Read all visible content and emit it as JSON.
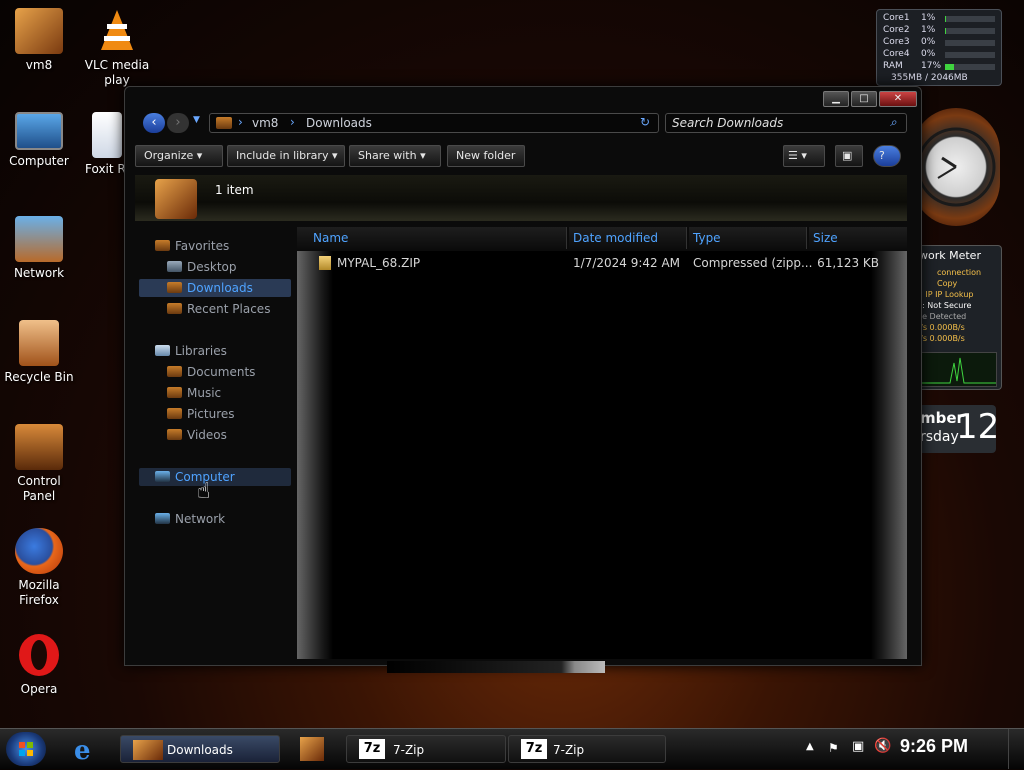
{
  "desktop": {
    "icons": [
      {
        "label": "vm8"
      },
      {
        "label": "VLC media play"
      },
      {
        "label": "Computer"
      },
      {
        "label": "Foxit R"
      },
      {
        "label": "Network"
      },
      {
        "label": "Recycle Bin"
      },
      {
        "label": "Control Panel"
      },
      {
        "label": "Mozilla Firefox"
      },
      {
        "label": "Opera"
      }
    ]
  },
  "gadgets": {
    "cpu_meter": {
      "rows": [
        {
          "name": "Core1",
          "value": "1%",
          "level": 0.01
        },
        {
          "name": "Core2",
          "value": "1%",
          "level": 0.01
        },
        {
          "name": "Core3",
          "value": "0%",
          "level": 0
        },
        {
          "name": "Core4",
          "value": "0%",
          "level": 0
        },
        {
          "name": "RAM",
          "value": "17%",
          "level": 0.17
        }
      ],
      "memory": "355MB / 2046MB"
    },
    "network_meter": {
      "title": "work Meter",
      "lines": [
        "connection Copy",
        "t: IP   IP Lookup",
        "n: Not Secure",
        "ne Detected",
        "t/s   0.000B/s",
        "t/s   0.000B/s"
      ]
    },
    "calendar": {
      "month_partial": "mber",
      "weekday_partial": "rsday",
      "day": "12"
    }
  },
  "explorer": {
    "title_buttons": {
      "minimize": "▁",
      "maximize": "□",
      "close": "✕"
    },
    "breadcrumb": [
      "vm8",
      "Downloads"
    ],
    "search_placeholder": "Search Downloads",
    "toolbar": {
      "organize": "Organize",
      "include_in_library": "Include in library",
      "share_with": "Share with",
      "new_folder": "New folder"
    },
    "item_count": "1 item",
    "nav": {
      "favorites": "Favorites",
      "desktop": "Desktop",
      "downloads": "Downloads",
      "recent_places": "Recent Places",
      "libraries": "Libraries",
      "documents": "Documents",
      "music": "Music",
      "pictures": "Pictures",
      "videos": "Videos",
      "computer": "Computer",
      "network": "Network"
    },
    "columns": {
      "name": "Name",
      "date_modified": "Date modified",
      "type": "Type",
      "size": "Size"
    },
    "files": [
      {
        "name": "MYPAL_68.ZIP",
        "date_modified": "1/7/2024 9:42 AM",
        "type": "Compressed (zipp...",
        "size": "61,123 KB"
      }
    ]
  },
  "taskbar": {
    "tasks": [
      {
        "label": "Downloads"
      },
      {
        "label": "7-Zip"
      },
      {
        "label": "7-Zip"
      }
    ],
    "seven_zip_glyph": "7z",
    "clock": "9:26 PM"
  },
  "colors": {
    "accent": "#4fa3ff",
    "cpu_bar": "#3fd43f",
    "selection": "#2a3a55"
  }
}
